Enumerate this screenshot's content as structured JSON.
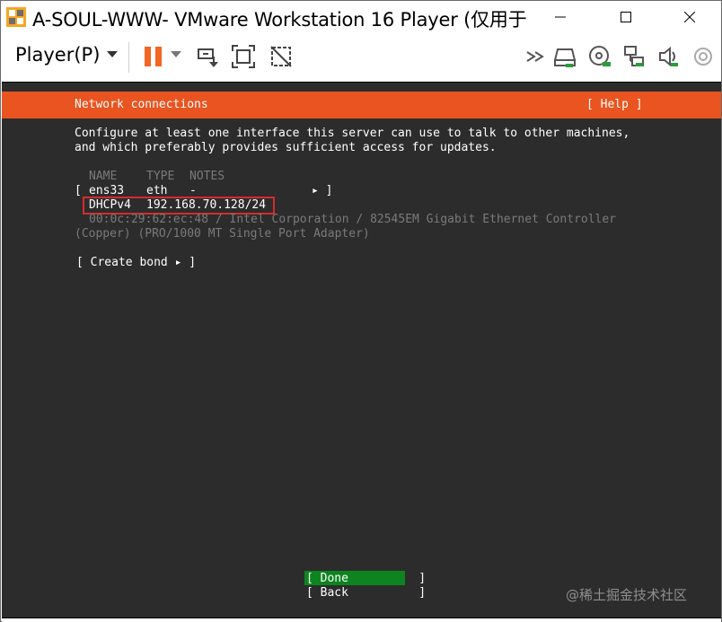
{
  "window": {
    "title": "A-SOUL-WWW- VMware Workstation 16 Player (仅用于"
  },
  "toolbar": {
    "player_menu": "Player(P)",
    "icons": [
      "pause-icon",
      "dropdown-icon",
      "send-ctrl-alt-del-icon",
      "fullscreen-icon",
      "unity-icon",
      "forward-icon",
      "hard-disk-icon",
      "cd-icon",
      "network-icon",
      "sound-icon",
      "usb-icon"
    ]
  },
  "installer": {
    "header_title": "Network connections",
    "header_help": "[ Help ]",
    "intro_line1": "Configure at least one interface this server can use to talk to other machines,",
    "intro_line2": "and which preferably provides sufficient access for updates.",
    "columns": {
      "name": "NAME",
      "type": "TYPE",
      "notes": "NOTES"
    },
    "interface": {
      "open_bracket": "[",
      "name": "ens33",
      "type": "eth",
      "notes": "-",
      "arrow_close": "▸ ]",
      "dhcp_label": "DHCPv4",
      "ip": "192.168.70.128/24",
      "hw_line1": "00:0c:29:62:ec:48 / Intel Corporation / 82545EM Gigabit Ethernet Controller",
      "hw_line2": "(Copper) (PRO/1000 MT Single Port Adapter)"
    },
    "create_bond": "[ Create bond ▸ ]",
    "done_button": "[ Done          ]",
    "back_button": "[ Back          ]"
  },
  "colors": {
    "header": "#e95420",
    "terminal_bg": "#2c2c2c",
    "done_bg": "#0e8420",
    "highlight_box": "#d62b2b"
  },
  "watermark": "@稀土掘金技术社区"
}
